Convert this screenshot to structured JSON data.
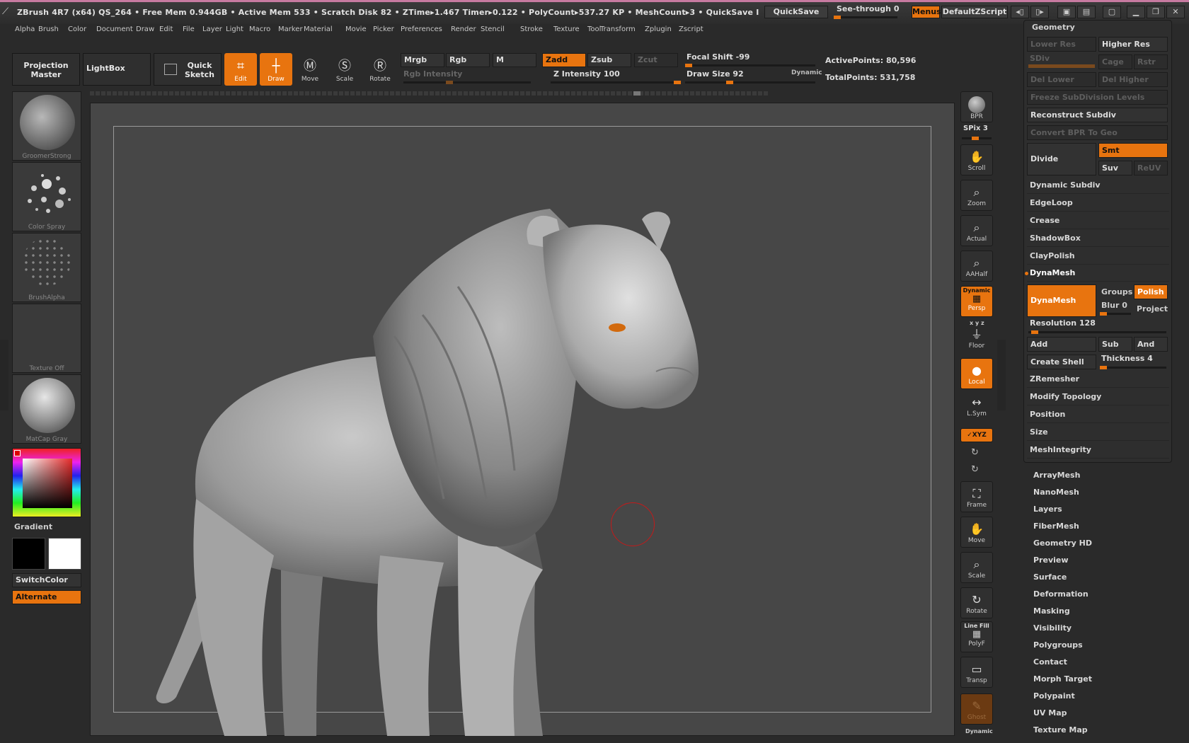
{
  "titlebar": {
    "title": "ZBrush 4R7 (x64)   QS_264    • Free Mem 0.944GB • Active Mem 533 • Scratch Disk 82 •  ZTime▸1.467  Timer▸0.122 • PolyCount▸537.27 KP  • MeshCount▸3  • QuickSave I",
    "quicksave": "QuickSave",
    "see_through": "See-through  0",
    "menus": "Menus",
    "default_zscript": "DefaultZScript"
  },
  "menubar": [
    "Alpha",
    "Brush",
    "Color",
    "Document",
    "Draw",
    "Edit",
    "File",
    "Layer",
    "Light",
    "Macro",
    "Marker",
    "Material",
    "Movie",
    "Picker",
    "Preferences",
    "Render",
    "Stencil",
    "Stroke",
    "Texture",
    "Tool",
    "Transform",
    "Zplugin",
    "Zscript"
  ],
  "shelf": {
    "projection_master": "Projection Master",
    "lightbox": "LightBox",
    "quick_sketch": "Quick Sketch",
    "edit": "Edit",
    "draw": "Draw",
    "move": "Move",
    "scale": "Scale",
    "rotate": "Rotate",
    "mrgb": "Mrgb",
    "rgb": "Rgb",
    "m": "M",
    "zadd": "Zadd",
    "zsub": "Zsub",
    "zcut": "Zcut",
    "rgb_intensity": "Rgb  Intensity",
    "z_intensity": "Z Intensity 100",
    "focal_shift": "Focal Shift -99",
    "draw_size": "Draw  Size 92",
    "dynamic": "Dynamic",
    "active_points": "ActivePoints: 80,596",
    "total_points": "TotalPoints: 531,758"
  },
  "left": {
    "brush": "GroomerStrong",
    "stroke": "Color  Spray",
    "alpha": "BrushAlpha",
    "texture": "Texture  Off",
    "material": "MatCap  Gray",
    "gradient": "Gradient",
    "switch_color": "SwitchColor",
    "alternate": "Alternate"
  },
  "view": {
    "bpr": "BPR",
    "spix": "SPix 3",
    "scroll": "Scroll",
    "zoom": "Zoom",
    "actual": "Actual",
    "aahalf": "AAHalf",
    "dynamic": "Dynamic",
    "persp": "Persp",
    "xyz_small": "x y z",
    "floor": "Floor",
    "local": "Local",
    "lsym": "L.Sym",
    "xyz": "✓XYZ",
    "frame": "Frame",
    "move": "Move",
    "scale": "Scale",
    "rotate": "Rotate",
    "line_fill": "Line Fill",
    "polyf": "PolyF",
    "transp": "Transp",
    "ghost": "Ghost",
    "dynamic_bottom": "Dynamic"
  },
  "geometry": {
    "header": "Geometry",
    "lower_res": "Lower Res",
    "higher_res": "Higher Res",
    "sdiv": "SDiv",
    "cage": "Cage",
    "rstr": "Rstr",
    "del_lower": "Del Lower",
    "del_higher": "Del Higher",
    "freeze": "Freeze SubDivision Levels",
    "reconstruct": "Reconstruct Subdiv",
    "convert_bpr": "Convert BPR To Geo",
    "divide": "Divide",
    "smt": "Smt",
    "suv": "Suv",
    "reuv": "ReUV",
    "sections": [
      "Dynamic Subdiv",
      "EdgeLoop",
      "Crease",
      "ShadowBox",
      "ClayPolish"
    ],
    "dynamesh_section": "DynaMesh",
    "dynamesh_btn": "DynaMesh",
    "groups": "Groups",
    "polish": "Polish",
    "blur": "Blur 0",
    "project": "Project",
    "resolution": "Resolution 128",
    "add": "Add",
    "sub": "Sub",
    "and": "And",
    "create_shell": "Create Shell",
    "thickness": "Thickness 4",
    "sections2": [
      "ZRemesher",
      "Modify Topology",
      "Position",
      "Size",
      "MeshIntegrity"
    ]
  },
  "subpalettes": [
    "ArrayMesh",
    "NanoMesh",
    "Layers",
    "FiberMesh",
    "Geometry HD",
    "Preview",
    "Surface",
    "Deformation",
    "Masking",
    "Visibility",
    "Polygroups",
    "Contact",
    "Morph Target",
    "Polypaint",
    "UV Map",
    "Texture Map"
  ],
  "colors": {
    "accent": "#e8740f",
    "background": "#2a2a2a",
    "canvas": "#474747"
  }
}
